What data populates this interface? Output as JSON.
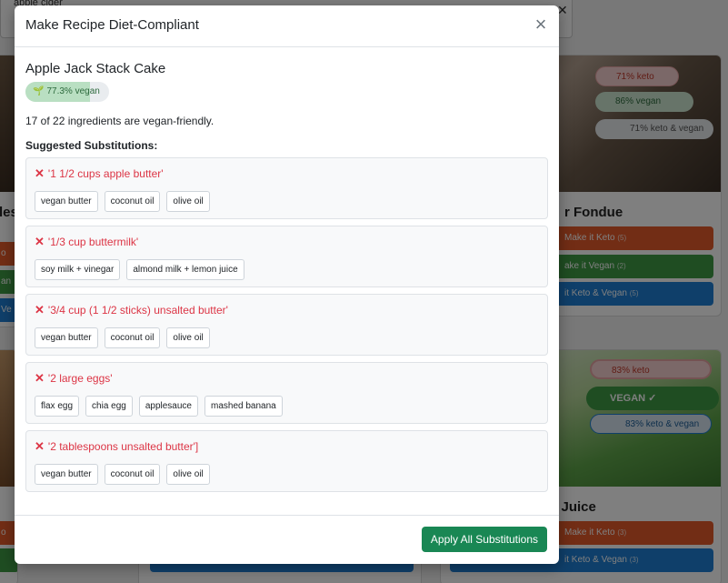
{
  "background": {
    "search_chip": "apple cider",
    "card_right_top": {
      "title": "r Fondue",
      "badges": [
        "71% keto",
        "86% vegan",
        "71% keto & vegan"
      ],
      "buttons": [
        "Make it Keto",
        "ake it Vegan",
        "it Keto & Vegan"
      ],
      "button_counts": [
        "(5)",
        "(2)",
        "(5)"
      ]
    },
    "card_right_bottom": {
      "title": "y Juice",
      "badges": [
        "83% keto",
        "VEGAN ✓",
        "83% keto & vegan"
      ],
      "buttons": [
        "Make it Keto",
        "it Keto & Vegan"
      ],
      "button_counts": [
        "(3)",
        "(3)"
      ]
    },
    "card_left_top": {
      "title": "les",
      "buttons": [
        "o",
        "an",
        "Ve"
      ]
    },
    "card_left_bottom": {
      "buttons": [
        "o"
      ]
    }
  },
  "modal": {
    "title": "Make Recipe Diet-Compliant",
    "close_label": "×",
    "recipe_title": "Apple Jack Stack Cake",
    "vegan_badge": "77.3% vegan",
    "vegan_percent": 77.3,
    "summary": "17 of 22 ingredients are vegan-friendly.",
    "substitutions_heading": "Suggested Substitutions:",
    "substitutions": [
      {
        "original": "'1 1/2 cups apple butter'",
        "options": [
          "vegan butter",
          "coconut oil",
          "olive oil"
        ]
      },
      {
        "original": "'1/3 cup buttermilk'",
        "options": [
          "soy milk + vinegar",
          "almond milk + lemon juice"
        ]
      },
      {
        "original": "'3/4 cup (1 1/2 sticks) unsalted butter'",
        "options": [
          "vegan butter",
          "coconut oil",
          "olive oil"
        ]
      },
      {
        "original": "'2 large eggs'",
        "options": [
          "flax egg",
          "chia egg",
          "applesauce",
          "mashed banana"
        ]
      },
      {
        "original": "'2 tablespoons unsalted butter']",
        "options": [
          "vegan butter",
          "coconut oil",
          "olive oil"
        ]
      }
    ],
    "apply_label": "Apply All Substitutions"
  },
  "colors": {
    "danger": "#dc3545",
    "success": "#198754",
    "keto_orange": "#e55a2b",
    "vegan_green": "#3f9a45",
    "combo_blue": "#1e7fd4"
  }
}
